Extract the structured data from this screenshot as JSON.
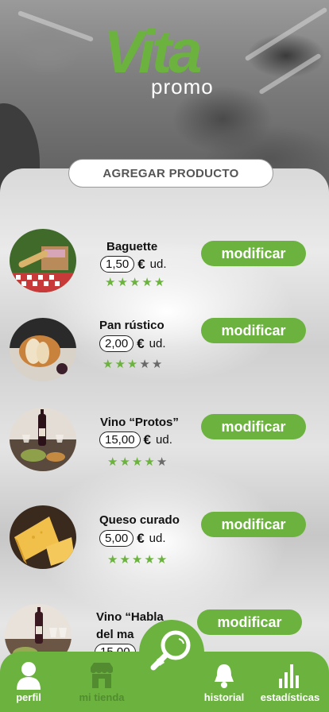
{
  "brand": {
    "logo_main": "Vita",
    "logo_sub": "promo"
  },
  "add_product_label": "AGREGAR PRODUCTO",
  "products": [
    {
      "name": "Baguette",
      "price": "1,50",
      "currency": "€",
      "unit": "ud.",
      "rating": 5,
      "action": "modificar"
    },
    {
      "name": "Pan rústico",
      "price": "2,00",
      "currency": "€",
      "unit": "ud.",
      "rating": 3,
      "action": "modificar"
    },
    {
      "name": "Vino “Protos”",
      "price": "15,00",
      "currency": "€",
      "unit": "ud.",
      "rating": 4,
      "action": "modificar"
    },
    {
      "name": "Queso curado",
      "price": "5,00",
      "currency": "€",
      "unit": "ud.",
      "rating": 5,
      "action": "modificar"
    },
    {
      "name_line1": "Vino “Habla",
      "name_line2": "del ma",
      "price": "15,00",
      "action": "modificar"
    }
  ],
  "nav": {
    "items": [
      {
        "label": "perfil",
        "icon": "user-icon"
      },
      {
        "label": "mi tienda",
        "icon": "store-icon"
      },
      {
        "label": "",
        "icon": "search-icon"
      },
      {
        "label": "historial",
        "icon": "bell-icon"
      },
      {
        "label": "estadísticas",
        "icon": "bar-chart-icon"
      }
    ]
  },
  "colors": {
    "accent": "#6cb23f",
    "star_off": "#6a6a6a"
  }
}
